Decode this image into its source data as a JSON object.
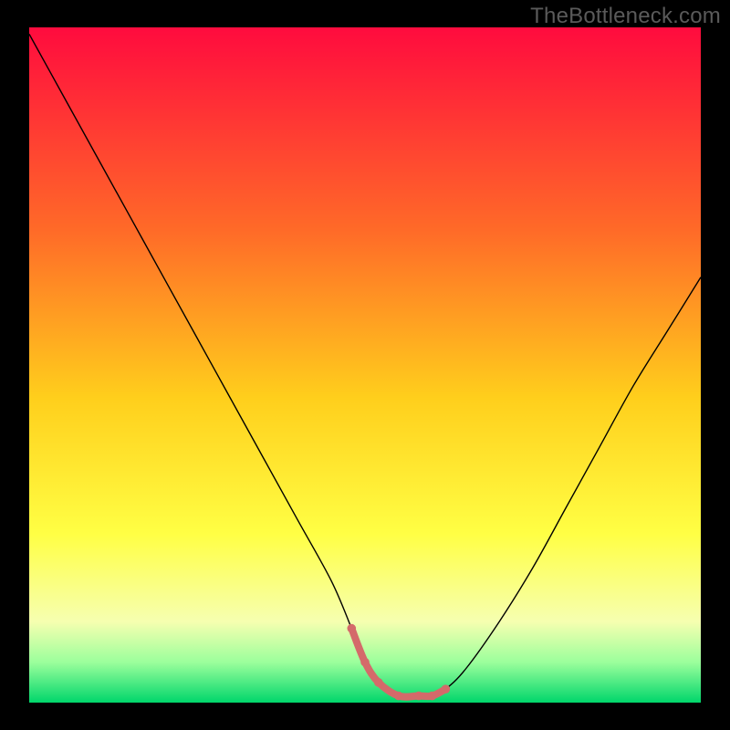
{
  "watermark": "TheBottleneck.com",
  "chart_data": {
    "type": "line",
    "title": "",
    "xlabel": "",
    "ylabel": "",
    "xlim": [
      0,
      100
    ],
    "ylim": [
      0,
      100
    ],
    "grid": false,
    "legend": false,
    "x": [
      0,
      5,
      10,
      15,
      20,
      25,
      30,
      35,
      40,
      45,
      48,
      50,
      52,
      55,
      58,
      60,
      62,
      65,
      70,
      75,
      80,
      85,
      90,
      95,
      100
    ],
    "values": [
      99,
      90,
      81,
      72,
      63,
      54,
      45,
      36,
      27,
      18,
      11,
      6,
      3,
      1,
      1,
      1,
      2,
      5,
      12,
      20,
      29,
      38,
      47,
      55,
      63
    ],
    "background_gradient_stops": [
      {
        "pct": 0,
        "color": "#ff0b3e"
      },
      {
        "pct": 30,
        "color": "#ff6a28"
      },
      {
        "pct": 55,
        "color": "#ffcf1c"
      },
      {
        "pct": 75,
        "color": "#ffff44"
      },
      {
        "pct": 88,
        "color": "#f6ffb0"
      },
      {
        "pct": 94,
        "color": "#9cff9c"
      },
      {
        "pct": 100,
        "color": "#00d66b"
      }
    ],
    "curve_stroke_color": "#000000",
    "curve_stroke_width": 1.4,
    "notch_segment": {
      "color": "#d46a6a",
      "width": 8,
      "dots": true,
      "x": [
        48,
        50,
        52,
        55,
        58,
        60,
        62
      ],
      "values": [
        11,
        6,
        3,
        1,
        1,
        1,
        2
      ]
    }
  }
}
